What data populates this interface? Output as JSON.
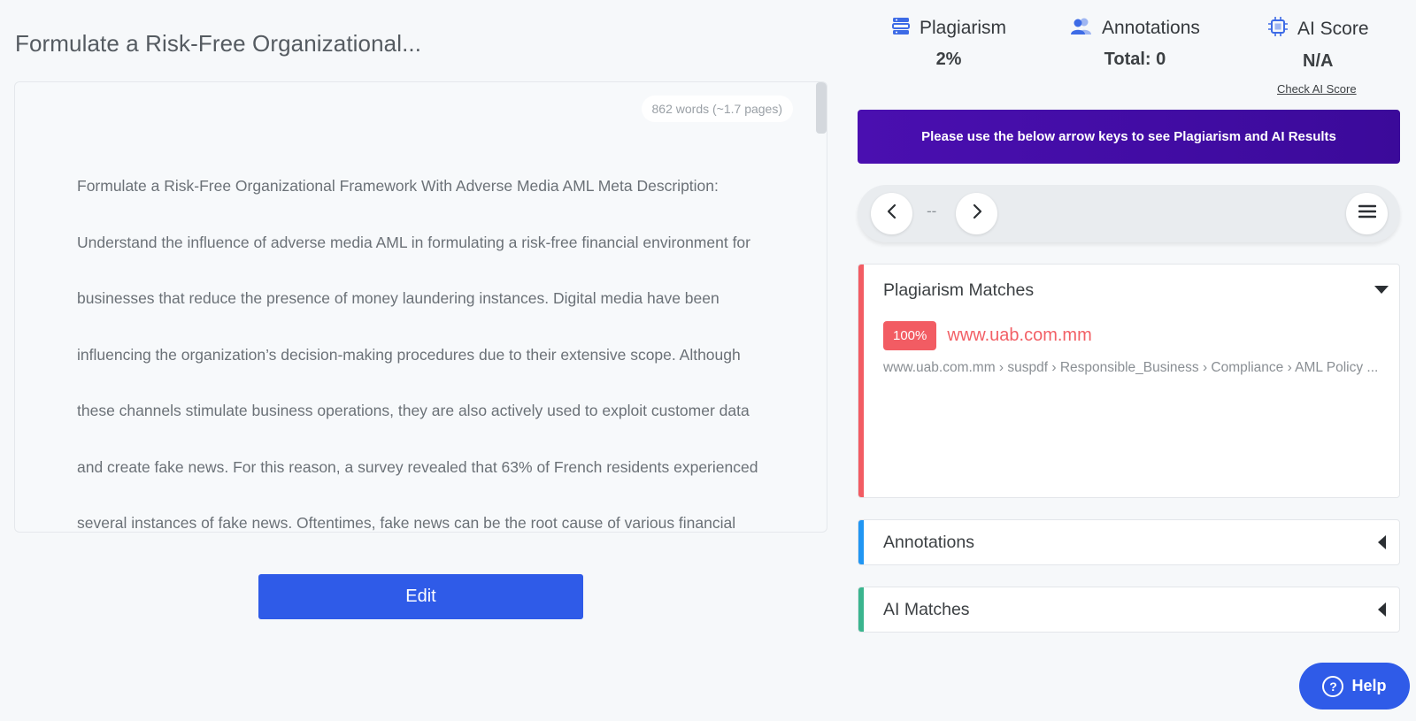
{
  "document": {
    "title": "Formulate a Risk-Free Organizational...",
    "word_count": "862 words (~1.7 pages)",
    "lines": [
      "Formulate a Risk-Free Organizational Framework With Adverse Media AML Meta Description:",
      "Understand the influence of adverse media AML in formulating a risk-free financial environment for",
      "businesses that reduce the presence of money laundering instances. Digital media have been",
      "influencing the organization’s decision-making procedures due to their extensive scope. Although",
      "these channels stimulate business operations, they are also actively used to exploit customer data",
      "and create fake news. For this reason, a survey revealed that 63% of French residents experienced",
      "several instances of fake news. Oftentimes, fake news can be the root cause of various financial"
    ],
    "edit_label": "Edit"
  },
  "stats": {
    "plagiarism": {
      "label": "Plagiarism",
      "value": "2%",
      "icon": "server-stack-icon"
    },
    "annotations": {
      "label": "Annotations",
      "value": "Total: 0",
      "icon": "users-icon"
    },
    "ai_score": {
      "label": "AI Score",
      "value": "N/A",
      "icon": "ai-chip-icon"
    },
    "check_ai_label": "Check AI Score"
  },
  "banner": {
    "text": "Please use the below arrow keys to see Plagiarism and AI Results"
  },
  "navigator": {
    "index": "--"
  },
  "panels": {
    "plagiarism": {
      "title": "Plagiarism Matches",
      "match": {
        "percent": "100%",
        "site": "www.uab.com.mm",
        "path": "www.uab.com.mm › suspdf › Responsible_Business › Compliance › AML Policy ..."
      }
    },
    "annotations": {
      "title": "Annotations"
    },
    "ai_matches": {
      "title": "AI Matches"
    }
  },
  "help": {
    "label": "Help"
  },
  "colors": {
    "accent_blue": "#2f5be8",
    "banner_purple": "#4a0fb0",
    "plagiarism_red": "#f25c63",
    "annotations_blue": "#2196f3",
    "ai_green": "#3bb58e"
  }
}
